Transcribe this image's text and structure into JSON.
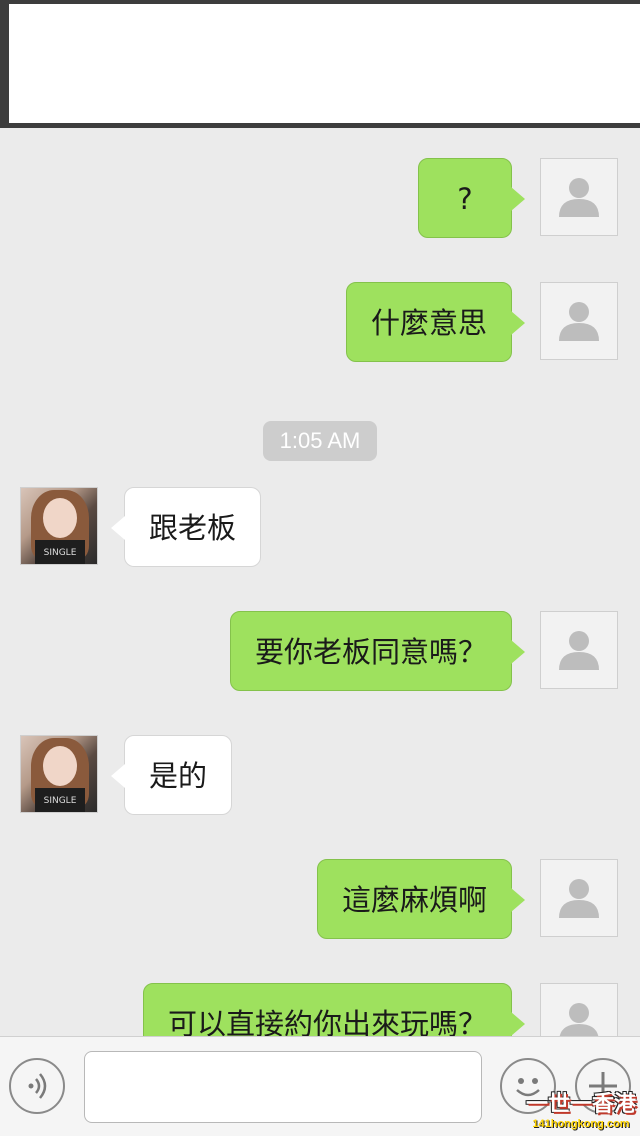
{
  "messages": [
    {
      "from": "me",
      "text": "?"
    },
    {
      "from": "me",
      "text": "什麼意思"
    },
    {
      "timestamp": "1:05 AM"
    },
    {
      "from": "other",
      "text": "跟老板"
    },
    {
      "from": "me",
      "text": "要你老板同意嗎？"
    },
    {
      "from": "other",
      "text": "是的"
    },
    {
      "from": "me",
      "text": "這麼麻煩啊"
    },
    {
      "from": "me",
      "text": "可以直接約你出來玩嗎？"
    }
  ],
  "avatar_other_shirt_text": "SINGLE",
  "input": {
    "value": "",
    "placeholder": ""
  },
  "icons": {
    "voice": "voice-icon",
    "emoji": "emoji-icon",
    "plus": "plus-icon",
    "default_avatar": "person-icon"
  },
  "watermark": {
    "main": "一世一香港",
    "sub": "141hongkong.com"
  },
  "colors": {
    "outgoing_bubble": "#9ee15e",
    "incoming_bubble": "#ffffff",
    "background": "#ebebeb"
  }
}
